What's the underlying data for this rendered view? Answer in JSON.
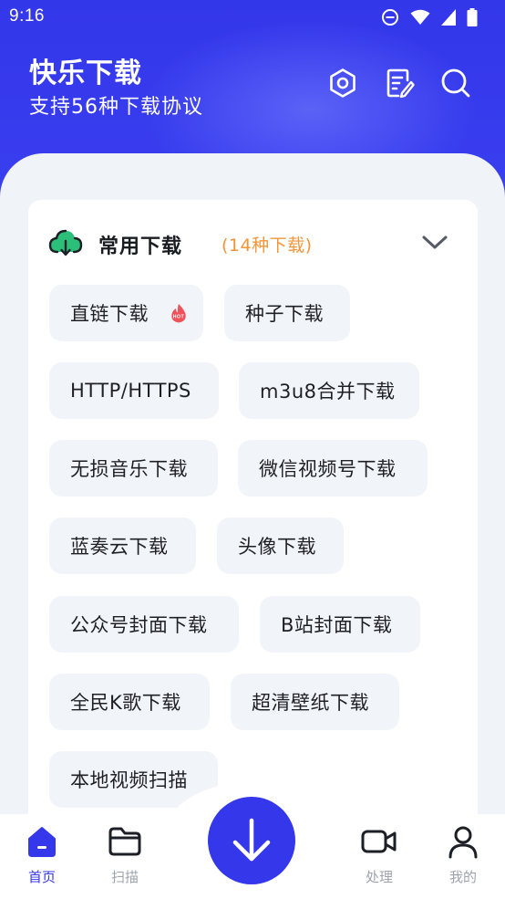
{
  "status_bar": {
    "time": "9:16"
  },
  "header": {
    "title": "快乐下载",
    "subtitle": "支持56种下载协议",
    "actions": [
      {
        "icon": "settings-icon"
      },
      {
        "icon": "edit-note-icon"
      },
      {
        "icon": "search-icon"
      }
    ]
  },
  "card": {
    "title": "常用下载",
    "count": "(14种下载)",
    "icon": "cloud-download-icon",
    "chips": [
      {
        "label": "直链下载",
        "hot": true
      },
      {
        "label": "种子下载"
      },
      {
        "label": "HTTP/HTTPS"
      },
      {
        "label": "m3u8合并下载"
      },
      {
        "label": "无损音乐下载"
      },
      {
        "label": "微信视频号下载"
      },
      {
        "label": "蓝奏云下载"
      },
      {
        "label": "头像下载"
      },
      {
        "label": "公众号封面下载"
      },
      {
        "label": "B站封面下载"
      },
      {
        "label": "全民K歌下载"
      },
      {
        "label": "超清壁纸下载"
      },
      {
        "label": "本地视频扫描"
      }
    ],
    "hot_badge_text": "HOT"
  },
  "bottom_nav": {
    "items": [
      {
        "label": "首页",
        "icon": "home-icon",
        "active": true
      },
      {
        "label": "扫描",
        "icon": "folder-icon"
      },
      {
        "label": "处理",
        "icon": "video-icon"
      },
      {
        "label": "我的",
        "icon": "user-icon"
      }
    ],
    "center_button": {
      "icon": "download-arrow-icon"
    }
  },
  "colors": {
    "primary": "#3438ea",
    "accent_orange": "#f2953a",
    "hot_red": "#f0525a",
    "cloud_green": "#2bbf7a",
    "chip_bg": "#f1f4f8",
    "page_bg": "#f0f3f7"
  }
}
